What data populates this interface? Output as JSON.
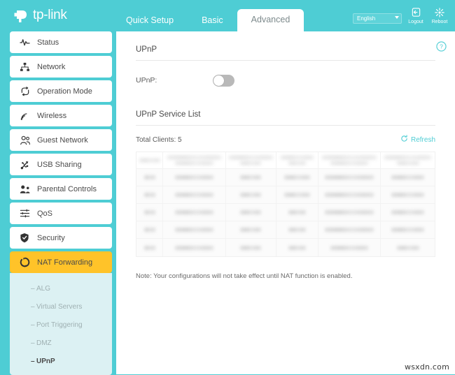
{
  "brand": {
    "name": "tp-link",
    "logo_icon": "tplink-logo-icon"
  },
  "header": {
    "tabs": [
      {
        "label": "Quick Setup",
        "active": false
      },
      {
        "label": "Basic",
        "active": false
      },
      {
        "label": "Advanced",
        "active": true
      }
    ],
    "language": {
      "selected": "English",
      "caret_icon": "chevron-down-icon"
    },
    "actions": [
      {
        "label": "Logout",
        "icon": "logout-icon"
      },
      {
        "label": "Reboot",
        "icon": "reboot-icon"
      }
    ]
  },
  "sidebar": {
    "items": [
      {
        "label": "Status",
        "icon": "pulse-icon",
        "active": false
      },
      {
        "label": "Network",
        "icon": "network-tree-icon",
        "active": false
      },
      {
        "label": "Operation Mode",
        "icon": "loop-arrows-icon",
        "active": false
      },
      {
        "label": "Wireless",
        "icon": "wifi-signal-icon",
        "active": false
      },
      {
        "label": "Guest Network",
        "icon": "people-icon",
        "active": false
      },
      {
        "label": "USB Sharing",
        "icon": "usb-icon",
        "active": false
      },
      {
        "label": "Parental Controls",
        "icon": "parental-controls-icon",
        "active": false
      },
      {
        "label": "QoS",
        "icon": "sliders-icon",
        "active": false
      },
      {
        "label": "Security",
        "icon": "shield-check-icon",
        "active": false
      },
      {
        "label": "NAT Forwarding",
        "icon": "nat-forwarding-icon",
        "active": true
      }
    ],
    "submenu": [
      {
        "label": "ALG",
        "active": false
      },
      {
        "label": "Virtual Servers",
        "active": false
      },
      {
        "label": "Port Triggering",
        "active": false
      },
      {
        "label": "DMZ",
        "active": false
      },
      {
        "label": "UPnP",
        "active": true
      }
    ],
    "active_color": "#FFC329",
    "submenu_bg": "#DCF1F3"
  },
  "main": {
    "help_icon": "help-question-icon",
    "upnp_section": {
      "title": "UPnP",
      "field_label": "UPnP:",
      "toggle_state": "off",
      "toggle_icon": "toggle-switch-icon"
    },
    "service_list": {
      "title": "UPnP Service List",
      "total_clients_label": "Total Clients: 5",
      "refresh_label": "Refresh",
      "refresh_icon": "refresh-icon",
      "table": {
        "redacted": true,
        "column_count": 6,
        "data_row_count": 5,
        "header_row": [
          "",
          "",
          "",
          "",
          "",
          ""
        ],
        "rows": [
          [
            "",
            "",
            "",
            "",
            "",
            ""
          ],
          [
            "",
            "",
            "",
            "",
            "",
            ""
          ],
          [
            "",
            "",
            "",
            "",
            "",
            ""
          ],
          [
            "",
            "",
            "",
            "",
            "",
            ""
          ],
          [
            "",
            "",
            "",
            "",
            "",
            ""
          ]
        ]
      }
    },
    "note": "Note: Your configurations will not take effect until NAT function is enabled."
  },
  "watermark": {
    "text": "wsxdn.com"
  },
  "colors": {
    "brand_teal": "#4ECDD4",
    "active_amber": "#FFC329",
    "submenu_cyan": "#DCF1F3",
    "content_white": "#FFFFFF"
  }
}
